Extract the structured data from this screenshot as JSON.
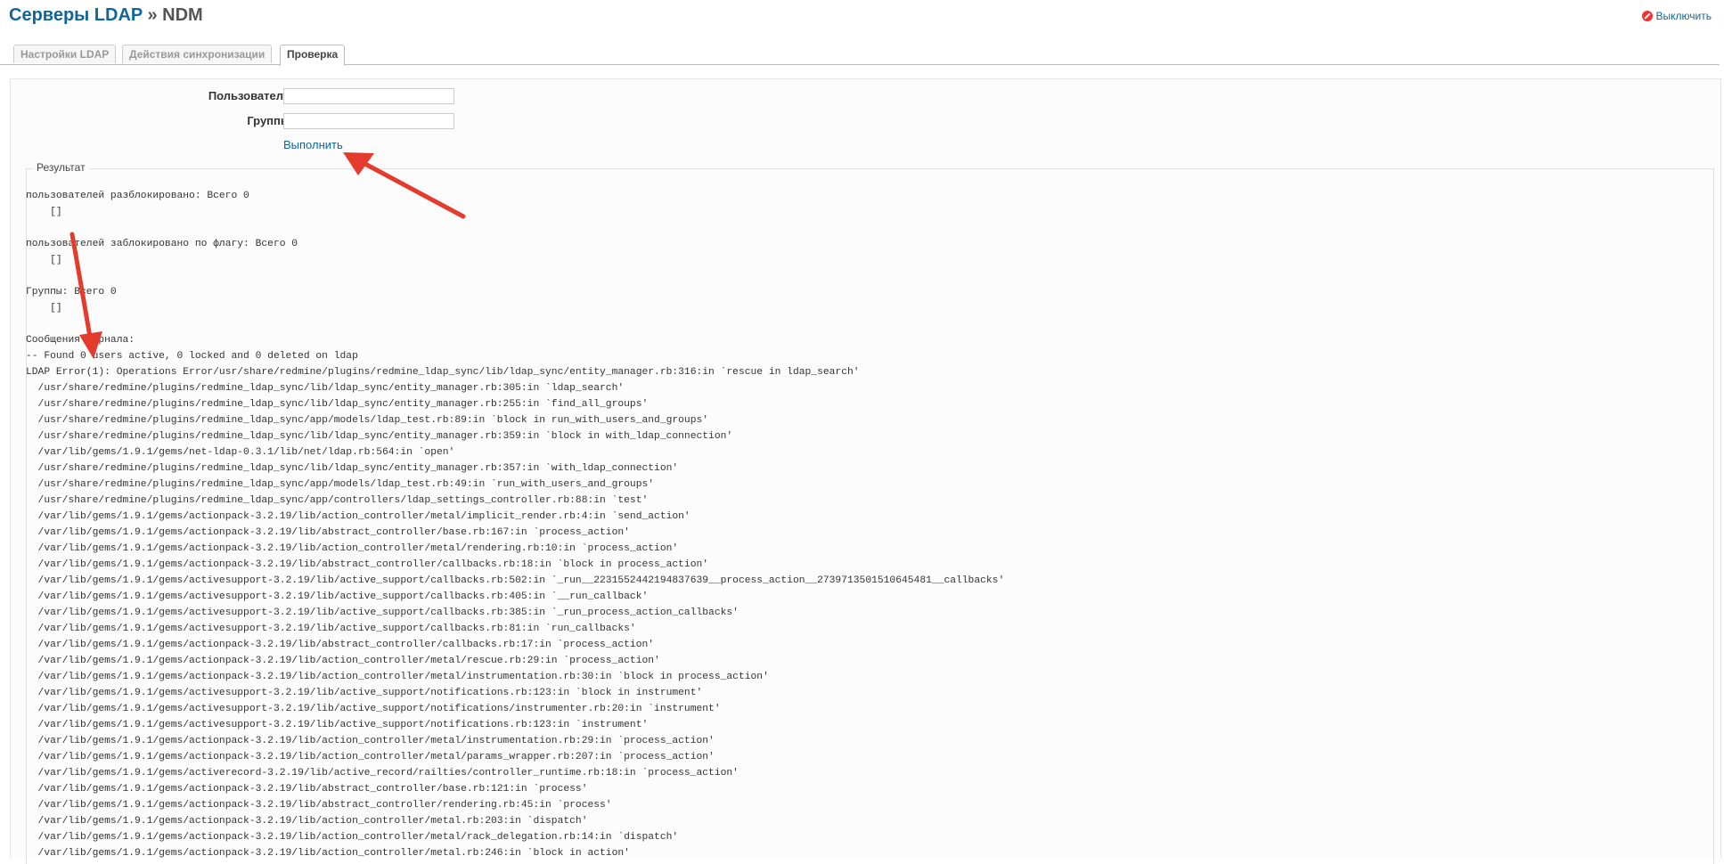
{
  "header": {
    "title_link": "Серверы LDAP",
    "title_sep": "»",
    "title_current": "NDM",
    "disable_label": "Выключить",
    "disable_icon": "disable-icon"
  },
  "tabs": [
    {
      "label": "Настройки LDAP"
    },
    {
      "label": "Действия синхронизации"
    },
    {
      "label": "Проверка"
    }
  ],
  "form": {
    "users_label": "Пользователи",
    "users_value": "",
    "groups_label": "Группы",
    "groups_value": "",
    "execute_label": "Выполнить"
  },
  "result": {
    "legend": "Результат",
    "log": "пользователей разблокировано: Всего 0\n    []\n\nпользователей заблокировано по флагу: Всего 0\n    []\n\nГруппы: Всего 0\n    []\n\nСообщения журнала:\n-- Found 0 users active, 0 locked and 0 deleted on ldap\nLDAP Error(1): Operations Error/usr/share/redmine/plugins/redmine_ldap_sync/lib/ldap_sync/entity_manager.rb:316:in `rescue in ldap_search'\n  /usr/share/redmine/plugins/redmine_ldap_sync/lib/ldap_sync/entity_manager.rb:305:in `ldap_search'\n  /usr/share/redmine/plugins/redmine_ldap_sync/lib/ldap_sync/entity_manager.rb:255:in `find_all_groups'\n  /usr/share/redmine/plugins/redmine_ldap_sync/app/models/ldap_test.rb:89:in `block in run_with_users_and_groups'\n  /usr/share/redmine/plugins/redmine_ldap_sync/lib/ldap_sync/entity_manager.rb:359:in `block in with_ldap_connection'\n  /var/lib/gems/1.9.1/gems/net-ldap-0.3.1/lib/net/ldap.rb:564:in `open'\n  /usr/share/redmine/plugins/redmine_ldap_sync/lib/ldap_sync/entity_manager.rb:357:in `with_ldap_connection'\n  /usr/share/redmine/plugins/redmine_ldap_sync/app/models/ldap_test.rb:49:in `run_with_users_and_groups'\n  /usr/share/redmine/plugins/redmine_ldap_sync/app/controllers/ldap_settings_controller.rb:88:in `test'\n  /var/lib/gems/1.9.1/gems/actionpack-3.2.19/lib/action_controller/metal/implicit_render.rb:4:in `send_action'\n  /var/lib/gems/1.9.1/gems/actionpack-3.2.19/lib/abstract_controller/base.rb:167:in `process_action'\n  /var/lib/gems/1.9.1/gems/actionpack-3.2.19/lib/action_controller/metal/rendering.rb:10:in `process_action'\n  /var/lib/gems/1.9.1/gems/actionpack-3.2.19/lib/abstract_controller/callbacks.rb:18:in `block in process_action'\n  /var/lib/gems/1.9.1/gems/activesupport-3.2.19/lib/active_support/callbacks.rb:502:in `_run__2231552442194837639__process_action__2739713501510645481__callbacks'\n  /var/lib/gems/1.9.1/gems/activesupport-3.2.19/lib/active_support/callbacks.rb:405:in `__run_callback'\n  /var/lib/gems/1.9.1/gems/activesupport-3.2.19/lib/active_support/callbacks.rb:385:in `_run_process_action_callbacks'\n  /var/lib/gems/1.9.1/gems/activesupport-3.2.19/lib/active_support/callbacks.rb:81:in `run_callbacks'\n  /var/lib/gems/1.9.1/gems/actionpack-3.2.19/lib/abstract_controller/callbacks.rb:17:in `process_action'\n  /var/lib/gems/1.9.1/gems/actionpack-3.2.19/lib/action_controller/metal/rescue.rb:29:in `process_action'\n  /var/lib/gems/1.9.1/gems/actionpack-3.2.19/lib/action_controller/metal/instrumentation.rb:30:in `block in process_action'\n  /var/lib/gems/1.9.1/gems/activesupport-3.2.19/lib/active_support/notifications.rb:123:in `block in instrument'\n  /var/lib/gems/1.9.1/gems/activesupport-3.2.19/lib/active_support/notifications/instrumenter.rb:20:in `instrument'\n  /var/lib/gems/1.9.1/gems/activesupport-3.2.19/lib/active_support/notifications.rb:123:in `instrument'\n  /var/lib/gems/1.9.1/gems/actionpack-3.2.19/lib/action_controller/metal/instrumentation.rb:29:in `process_action'\n  /var/lib/gems/1.9.1/gems/actionpack-3.2.19/lib/action_controller/metal/params_wrapper.rb:207:in `process_action'\n  /var/lib/gems/1.9.1/gems/activerecord-3.2.19/lib/active_record/railties/controller_runtime.rb:18:in `process_action'\n  /var/lib/gems/1.9.1/gems/actionpack-3.2.19/lib/abstract_controller/base.rb:121:in `process'\n  /var/lib/gems/1.9.1/gems/actionpack-3.2.19/lib/abstract_controller/rendering.rb:45:in `process'\n  /var/lib/gems/1.9.1/gems/actionpack-3.2.19/lib/action_controller/metal.rb:203:in `dispatch'\n  /var/lib/gems/1.9.1/gems/actionpack-3.2.19/lib/action_controller/metal/rack_delegation.rb:14:in `dispatch'\n  /var/lib/gems/1.9.1/gems/actionpack-3.2.19/lib/action_controller/metal.rb:246:in `block in action'"
  },
  "annotations": {
    "arrow_color": "#e53b2c"
  },
  "colors": {
    "link": "#116699",
    "tab_border": "#bbbbbb",
    "box_bg": "#fcfcfc"
  }
}
